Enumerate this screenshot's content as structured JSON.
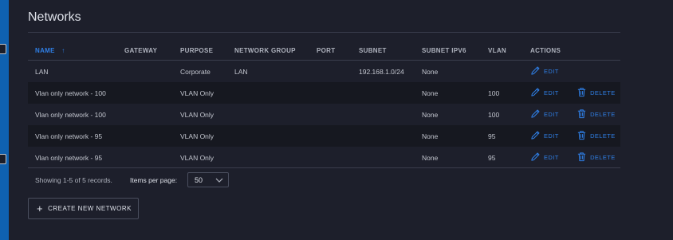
{
  "page": {
    "title": "Networks"
  },
  "table": {
    "headers": {
      "name": "NAME",
      "gateway": "GATEWAY",
      "purpose": "PURPOSE",
      "network_group": "NETWORK GROUP",
      "port": "PORT",
      "subnet": "SUBNET",
      "subnet_ipv6": "SUBNET IPV6",
      "vlan": "VLAN",
      "actions": "ACTIONS"
    },
    "sort_icon": "arrow-up-icon",
    "rows": [
      {
        "name": "LAN",
        "gateway": "",
        "purpose": "Corporate",
        "network_group": "LAN",
        "port": "",
        "subnet": "192.168.1.0/24",
        "subnet_ipv6": "None",
        "vlan": "",
        "edit": "EDIT",
        "delete": ""
      },
      {
        "name": "Vlan only network - 100",
        "gateway": "",
        "purpose": "VLAN Only",
        "network_group": "",
        "port": "",
        "subnet": "",
        "subnet_ipv6": "None",
        "vlan": "100",
        "edit": "EDIT",
        "delete": "DELETE"
      },
      {
        "name": "Vlan only network - 100",
        "gateway": "",
        "purpose": "VLAN Only",
        "network_group": "",
        "port": "",
        "subnet": "",
        "subnet_ipv6": "None",
        "vlan": "100",
        "edit": "EDIT",
        "delete": "DELETE"
      },
      {
        "name": "Vlan only network - 95",
        "gateway": "",
        "purpose": "VLAN Only",
        "network_group": "",
        "port": "",
        "subnet": "",
        "subnet_ipv6": "None",
        "vlan": "95",
        "edit": "EDIT",
        "delete": "DELETE"
      },
      {
        "name": "Vlan only network - 95",
        "gateway": "",
        "purpose": "VLAN Only",
        "network_group": "",
        "port": "",
        "subnet": "",
        "subnet_ipv6": "None",
        "vlan": "95",
        "edit": "EDIT",
        "delete": "DELETE"
      }
    ]
  },
  "footer": {
    "records_text": "Showing 1-5 of 5 records.",
    "items_per_page_label": "Items per page:",
    "items_per_page_value": "50"
  },
  "actions": {
    "create_label": "CREATE NEW NETWORK"
  },
  "colors": {
    "accent": "#2f7fe6",
    "background": "#1d1f2b",
    "row_alt": "#161820",
    "rail": "#0f61b0"
  }
}
